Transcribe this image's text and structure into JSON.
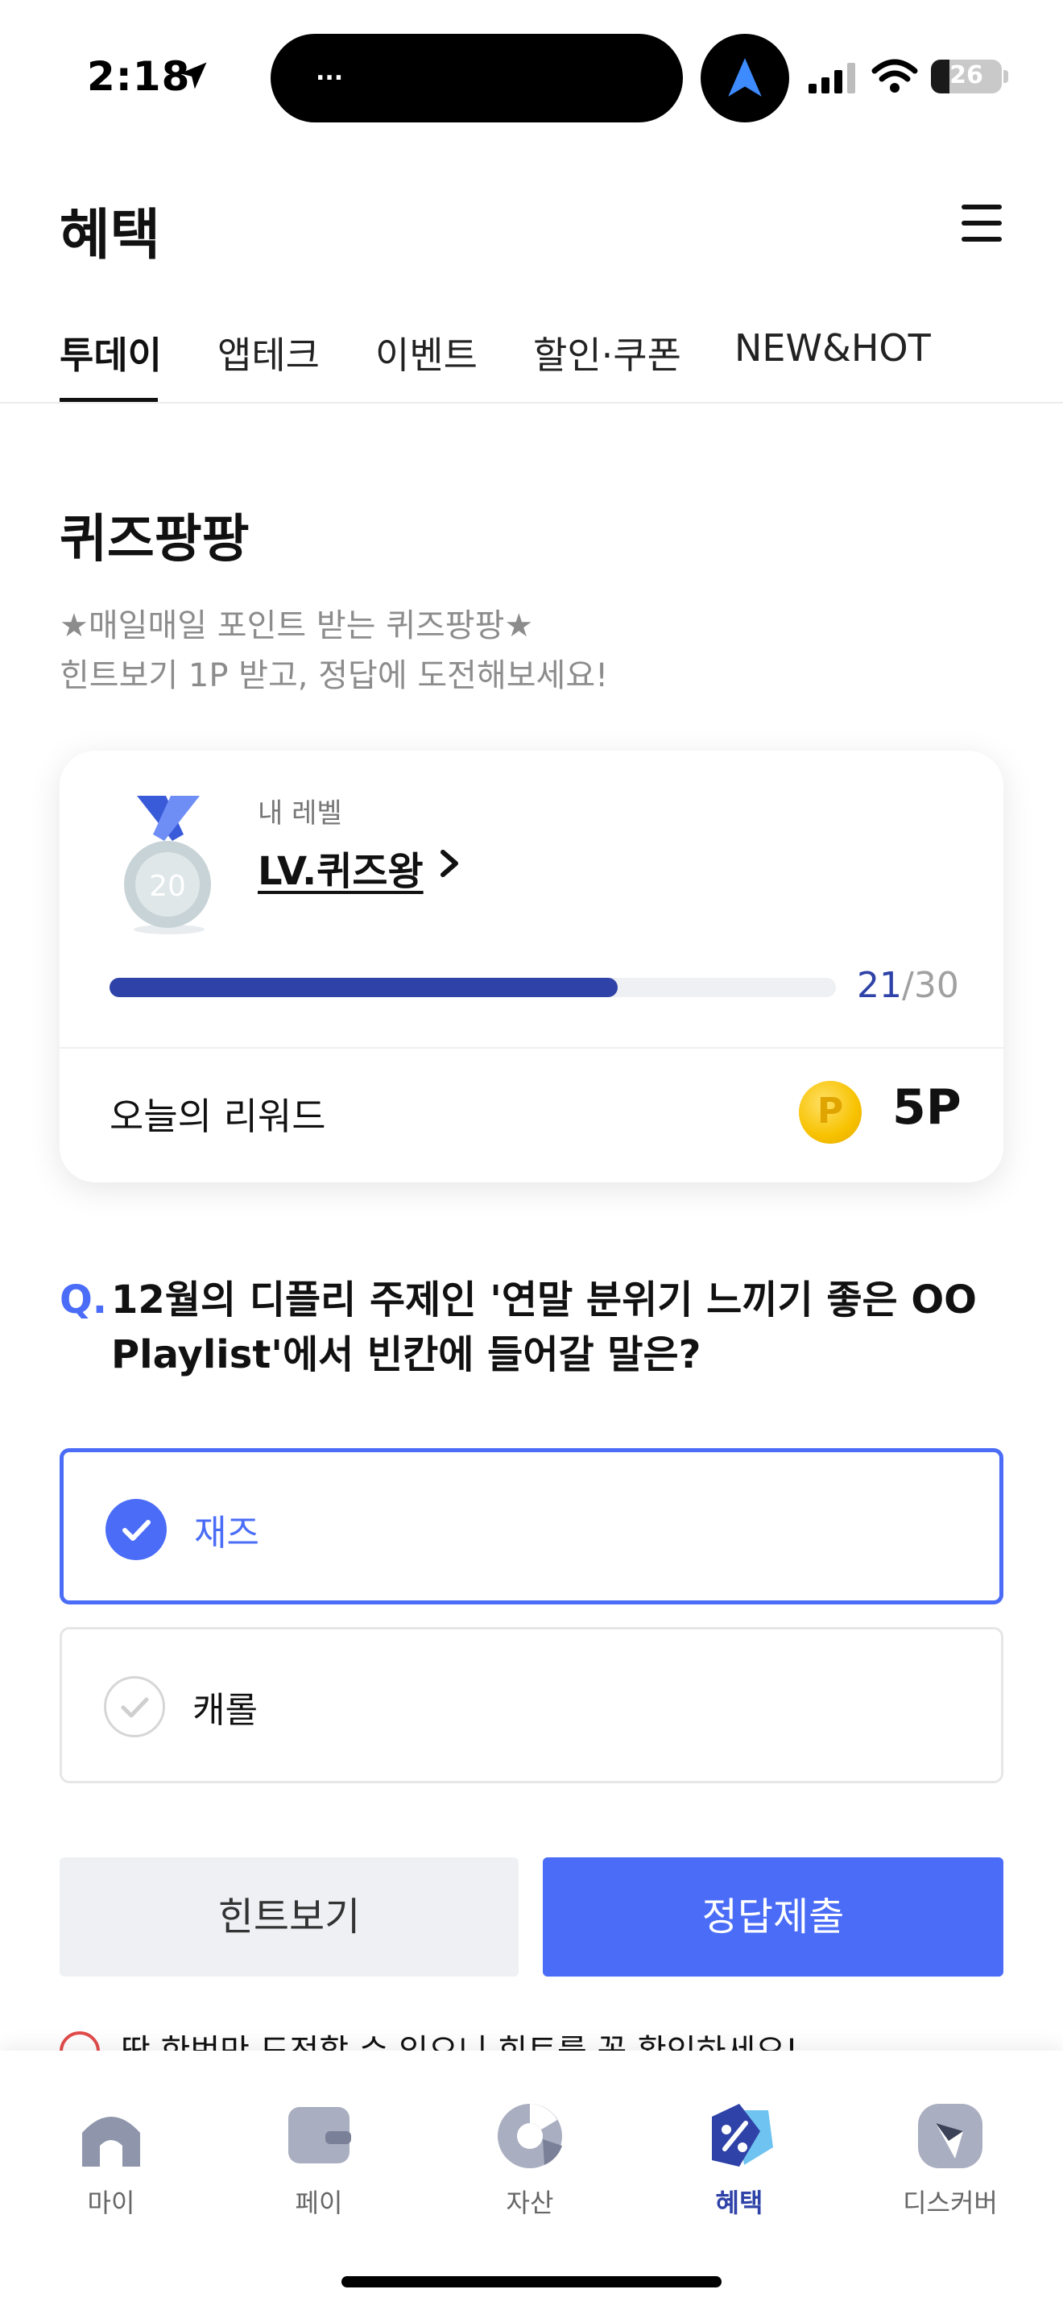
{
  "status_bar": {
    "time": "2:18",
    "island_text": "...",
    "battery": "26",
    "battery_level": 0.26
  },
  "header": {
    "title": "혜택"
  },
  "tabs": [
    {
      "label": "투데이",
      "active": true
    },
    {
      "label": "앱테크",
      "active": false
    },
    {
      "label": "이벤트",
      "active": false
    },
    {
      "label": "할인·쿠폰",
      "active": false
    },
    {
      "label": "NEW&HOT",
      "active": false
    }
  ],
  "quiz": {
    "title": "퀴즈팡팡",
    "subtitle_line1": "★매일매일 포인트 받는 퀴즈팡팡★",
    "subtitle_line2": "힌트보기 1P 받고, 정답에 도전해보세요!"
  },
  "level_card": {
    "medal_number": "20",
    "my_level_label": "내 레벨",
    "level_name": "LV.퀴즈왕",
    "progress_current": "21",
    "progress_total": "/30",
    "progress_fraction": 0.7,
    "reward_label": "오늘의 리워드",
    "coin_symbol": "P",
    "reward_value": "5P"
  },
  "question": {
    "prefix": "Q.",
    "text": "12월의 디플리 주제인 '연말 분위기 느끼기 좋은 OO Playlist'에서 빈칸에 들어갈 말은?"
  },
  "options": [
    {
      "label": "재즈",
      "selected": true
    },
    {
      "label": "캐롤",
      "selected": false
    }
  ],
  "buttons": {
    "hint": "힌트보기",
    "submit": "정답제출"
  },
  "warning": "딱 한번만 도전할 수 있으니 힌트를 꼭 확인하세요!",
  "bottom_nav": [
    {
      "label": "마이",
      "icon": "home-icon",
      "active": false
    },
    {
      "label": "페이",
      "icon": "wallet-icon",
      "active": false
    },
    {
      "label": "자산",
      "icon": "pie-chart-icon",
      "active": false
    },
    {
      "label": "혜택",
      "icon": "benefit-tag-icon",
      "active": true
    },
    {
      "label": "디스커버",
      "icon": "compass-icon",
      "active": false
    }
  ],
  "colors": {
    "accent": "#4a6cf7",
    "progress": "#2f42a8",
    "warning": "#e24b4b"
  }
}
